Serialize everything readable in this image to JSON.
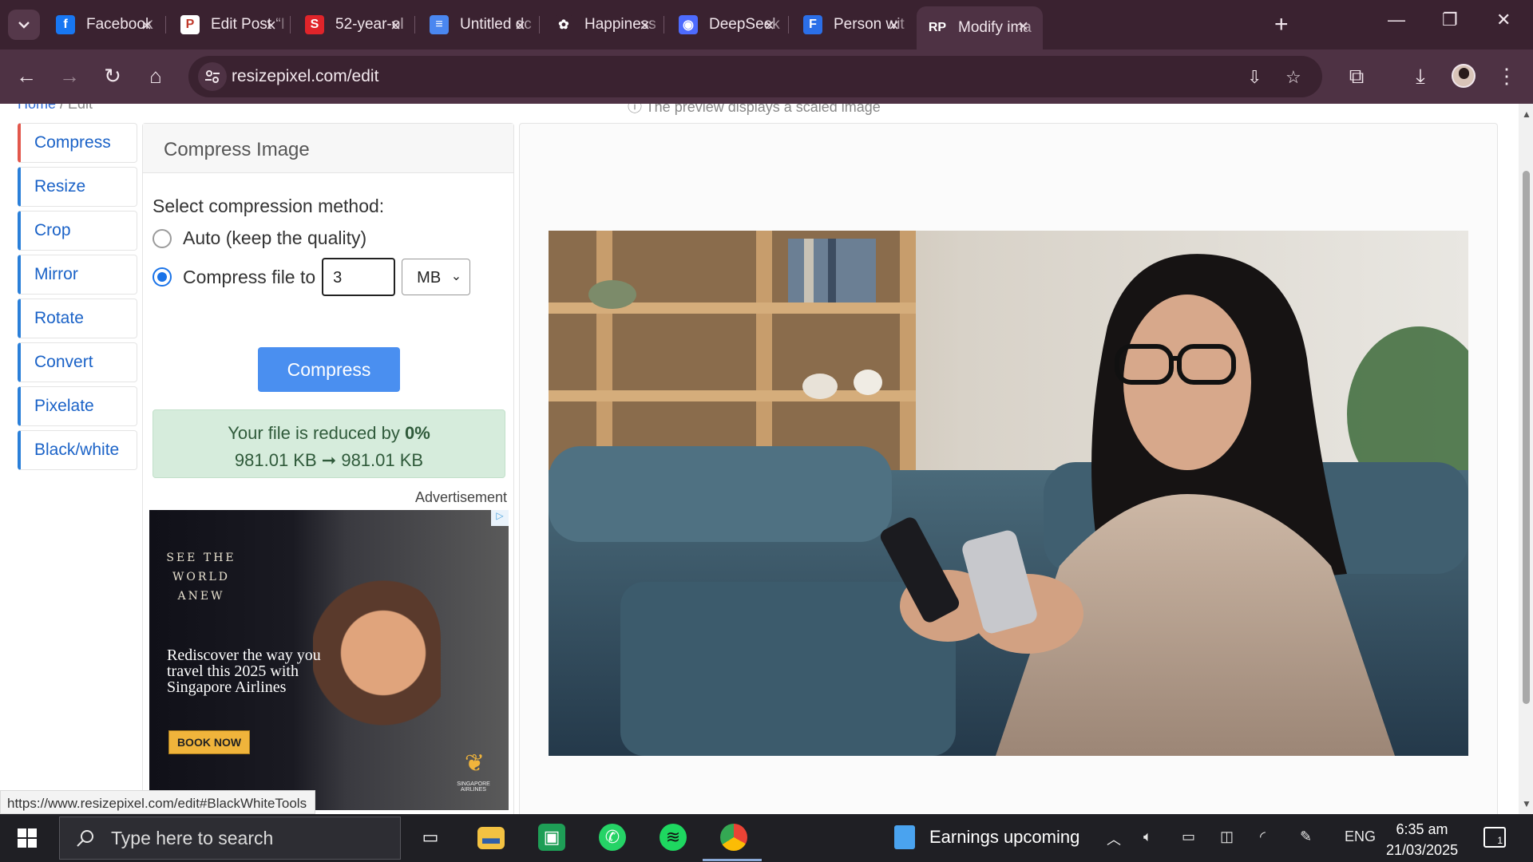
{
  "browser": {
    "tabs": [
      {
        "label": "Facebook",
        "favicon": "facebook-icon",
        "color": "#1877f2",
        "glyph": "f"
      },
      {
        "label": "Edit Post “I",
        "favicon": "blogger-post-icon",
        "color": "#ffffff",
        "glyph": "P"
      },
      {
        "label": "52-year-ol",
        "favicon": "scribd-s-icon",
        "color": "#e0242a",
        "glyph": "S"
      },
      {
        "label": "Untitled dc",
        "favicon": "google-docs-icon",
        "color": "#4a87f0",
        "glyph": "≡"
      },
      {
        "label": "Happiness",
        "favicon": "chatgpt-icon",
        "color": "#3a2230",
        "glyph": "✿"
      },
      {
        "label": "DeepSeek",
        "favicon": "deepseek-icon",
        "color": "#4d6bfe",
        "glyph": "◉"
      },
      {
        "label": "Person wit",
        "favicon": "google-forms-icon",
        "color": "#2b6fe8",
        "glyph": "F"
      },
      {
        "label": "Modify ima",
        "favicon": "resizepixel-icon",
        "color": "#4e3244",
        "glyph": "RP"
      }
    ],
    "active_tab_index": 7,
    "url": "resizepixel.com/edit",
    "status_url": "https://www.resizepixel.com/edit#BlackWhiteTools"
  },
  "page": {
    "breadcrumb_home": "Home",
    "breadcrumb_sep": " / ",
    "breadcrumb_current": "Edit",
    "notice": "ⓘ The preview displays a scaled image"
  },
  "sidebar": {
    "items": [
      {
        "label": "Compress",
        "active": true
      },
      {
        "label": "Resize"
      },
      {
        "label": "Crop"
      },
      {
        "label": "Mirror"
      },
      {
        "label": "Rotate"
      },
      {
        "label": "Convert"
      },
      {
        "label": "Pixelate"
      },
      {
        "label": "Black/white"
      }
    ]
  },
  "compress_panel": {
    "title": "Compress Image",
    "method_label": "Select compression method:",
    "option_auto": "Auto (keep the quality)",
    "option_file": "Compress file to",
    "selected_option": "file",
    "size_value": "3",
    "unit_value": "MB",
    "button_label": "Compress",
    "result_prefix": "Your file is reduced by ",
    "result_percent": "0%",
    "result_from": "981.01 KB",
    "result_arrow": " ➞ ",
    "result_to": "981.01 KB",
    "ad_label": "Advertisement"
  },
  "ad": {
    "tagline": "SEE THE WORLD ANEW",
    "headline": "Rediscover the way you travel this 2025 with Singapore Airlines",
    "cta": "BOOK NOW",
    "brand": "SINGAPORE AIRLINES"
  },
  "taskbar": {
    "search_placeholder": "Type here to search",
    "weather_text": "Earnings upcoming",
    "language": "ENG",
    "time": "6:35 am",
    "date": "21/03/2025",
    "notification_count": "1"
  },
  "colors": {
    "chrome_dark": "#3a2230",
    "chrome_toolbar": "#4e3244",
    "link_blue": "#1a62c7",
    "accent_red": "#e2574c",
    "button_blue": "#4a8ff0",
    "success_bg": "#d6ecdc"
  }
}
